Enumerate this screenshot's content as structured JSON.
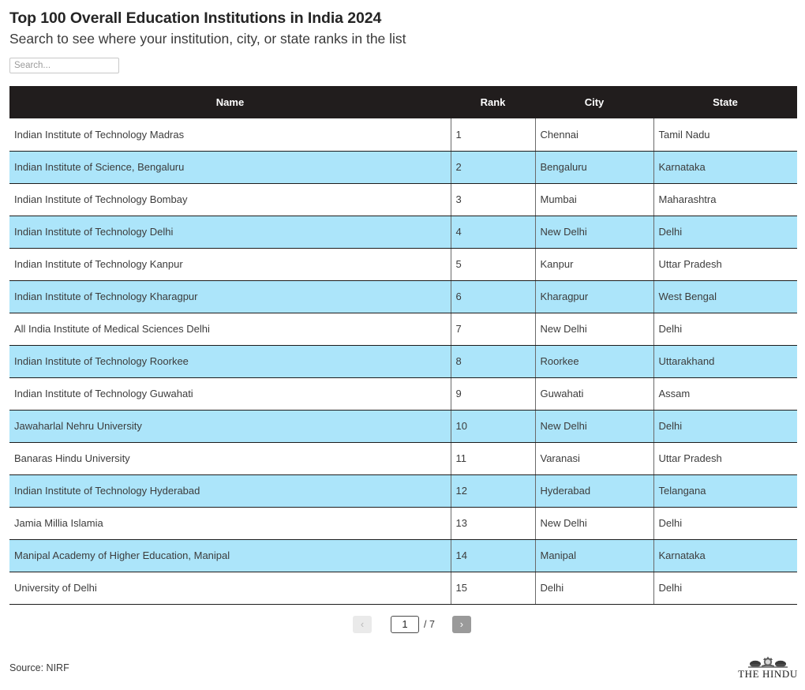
{
  "header": {
    "title": "Top 100 Overall Education Institutions in India 2024",
    "subtitle": "Search to see where your institution, city, or state ranks in the list"
  },
  "search": {
    "value": "",
    "placeholder": "Search..."
  },
  "table": {
    "columns": [
      {
        "key": "name",
        "label": "Name"
      },
      {
        "key": "rank",
        "label": "Rank"
      },
      {
        "key": "city",
        "label": "City"
      },
      {
        "key": "state",
        "label": "State"
      }
    ],
    "rows": [
      {
        "name": "Indian Institute of Technology Madras",
        "rank": "1",
        "city": "Chennai",
        "state": "Tamil Nadu"
      },
      {
        "name": "Indian Institute of Science, Bengaluru",
        "rank": "2",
        "city": "Bengaluru",
        "state": "Karnataka"
      },
      {
        "name": "Indian Institute of Technology Bombay",
        "rank": "3",
        "city": "Mumbai",
        "state": "Maharashtra"
      },
      {
        "name": "Indian Institute of Technology Delhi",
        "rank": "4",
        "city": "New Delhi",
        "state": "Delhi"
      },
      {
        "name": "Indian Institute of Technology Kanpur",
        "rank": "5",
        "city": "Kanpur",
        "state": "Uttar Pradesh"
      },
      {
        "name": "Indian Institute of Technology Kharagpur",
        "rank": "6",
        "city": "Kharagpur",
        "state": "West Bengal"
      },
      {
        "name": "All India Institute of Medical Sciences Delhi",
        "rank": "7",
        "city": "New Delhi",
        "state": "Delhi"
      },
      {
        "name": "Indian Institute of Technology Roorkee",
        "rank": "8",
        "city": "Roorkee",
        "state": "Uttarakhand"
      },
      {
        "name": "Indian Institute of Technology Guwahati",
        "rank": "9",
        "city": "Guwahati",
        "state": "Assam"
      },
      {
        "name": "Jawaharlal Nehru University",
        "rank": "10",
        "city": "New Delhi",
        "state": "Delhi"
      },
      {
        "name": "Banaras Hindu University",
        "rank": "11",
        "city": "Varanasi",
        "state": "Uttar Pradesh"
      },
      {
        "name": "Indian Institute of Technology Hyderabad",
        "rank": "12",
        "city": "Hyderabad",
        "state": "Telangana"
      },
      {
        "name": "Jamia Millia Islamia",
        "rank": "13",
        "city": "New Delhi",
        "state": "Delhi"
      },
      {
        "name": "Manipal Academy of Higher Education, Manipal",
        "rank": "14",
        "city": "Manipal",
        "state": "Karnataka"
      },
      {
        "name": "University of Delhi",
        "rank": "15",
        "city": "Delhi",
        "state": "Delhi"
      }
    ]
  },
  "pagination": {
    "prev_label": "‹",
    "next_label": "›",
    "current_page": "1",
    "total_label": "/ 7"
  },
  "footer": {
    "source": "Source: NIRF",
    "brand_name": "THE HINDU"
  },
  "colors": {
    "header_bg": "#211d1d",
    "row_highlight": "#ace5fa",
    "row_default": "#ffffff",
    "next_button_bg": "#9a9a9a",
    "prev_button_bg": "#eaeaea"
  }
}
